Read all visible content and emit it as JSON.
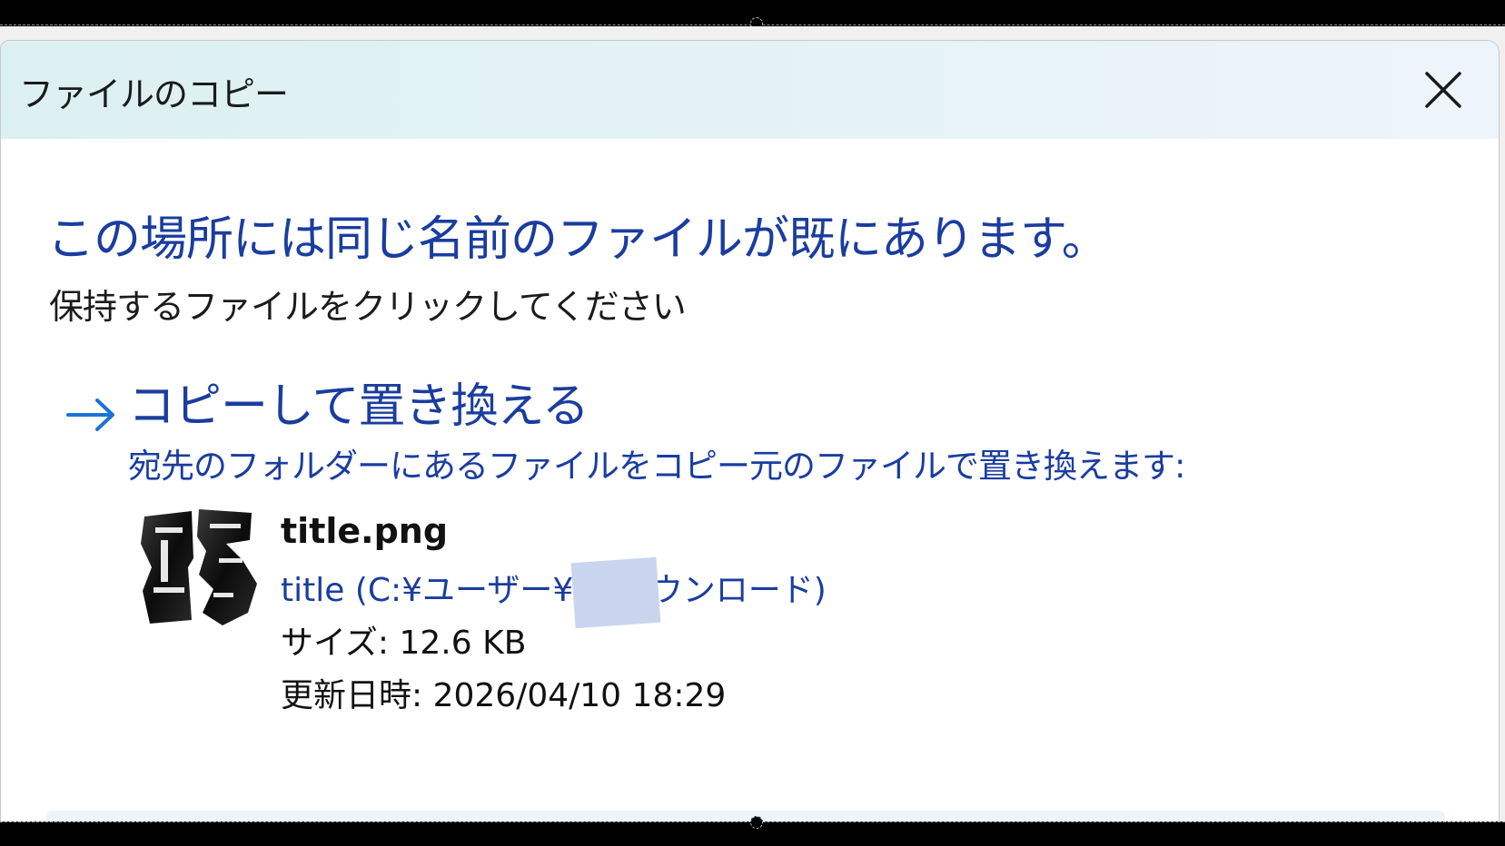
{
  "dialog": {
    "title": "ファイルのコピー",
    "close_icon": "close-icon"
  },
  "main": {
    "heading": "この場所には同じ名前のファイルが既にあります。",
    "subheading": "保持するファイルをクリックしてください"
  },
  "replace_option": {
    "arrow_icon": "arrow-right-icon",
    "title": "コピーして置き換える",
    "description": "宛先のフォルダーにあるファイルをコピー元のファイルで置き換えます:",
    "file": {
      "thumbnail_icon": "image-thumbnail-icon",
      "name": "title.png",
      "path": "title (C:¥ユーザー¥      t¥ダウンロード)",
      "size": "サイズ: 12.6 KB",
      "modified": "更新日時: 2026/04/10 18:29"
    }
  },
  "colors": {
    "accent_blue": "#1a3d9f",
    "arrow_blue": "#1a73d9",
    "titlebar": "#dcf0f1",
    "redaction": "#c9d5ef"
  }
}
